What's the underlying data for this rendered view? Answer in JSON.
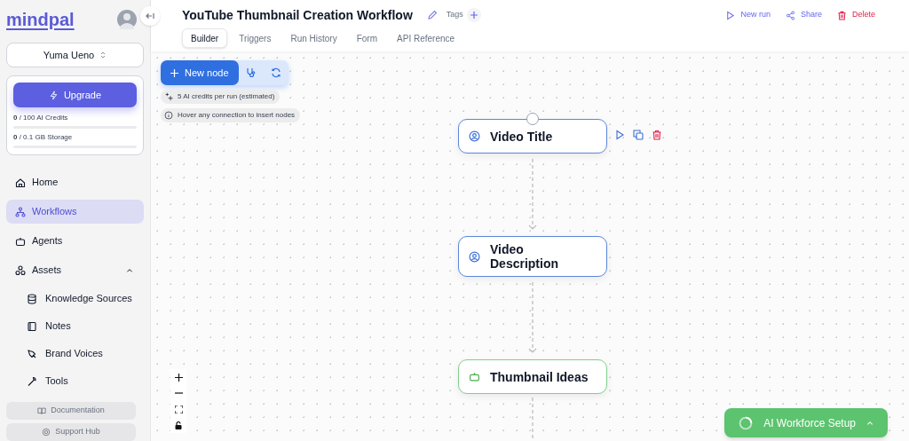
{
  "sidebar": {
    "logo": "mindpal",
    "user": "Yuma Ueno",
    "upgrade": "Upgrade",
    "usage": [
      {
        "used": "0",
        "label": "/ 100 AI Credits",
        "level": 0
      },
      {
        "used": "0",
        "label": "/ 0.1 GB Storage",
        "level": 0
      }
    ],
    "items": [
      {
        "label": "Home",
        "kind": "home",
        "selected": false
      },
      {
        "label": "Workflows",
        "kind": "workflow",
        "selected": true
      },
      {
        "label": "Agents",
        "kind": "robot",
        "selected": false
      },
      {
        "label": "Assets",
        "kind": "assets",
        "selected": false,
        "expanded": true,
        "children": [
          {
            "label": "Knowledge Sources",
            "kind": "database",
            "selected": false
          },
          {
            "label": "Notes",
            "kind": "notes",
            "selected": false
          },
          {
            "label": "Brand Voices",
            "kind": "pen",
            "selected": false
          },
          {
            "label": "Tools",
            "kind": "wrench",
            "selected": false
          }
        ]
      }
    ],
    "footer_links": [
      {
        "label": "Documentation",
        "kind": "book"
      },
      {
        "label": "Support Hub",
        "kind": "help"
      }
    ]
  },
  "header": {
    "title": "YouTube Thumbnail Creation Workflow",
    "tags_label": "Tags",
    "tabs": [
      {
        "label": "Builder",
        "selected": true
      },
      {
        "label": "Triggers",
        "selected": false
      },
      {
        "label": "Run History",
        "selected": false
      },
      {
        "label": "Form",
        "selected": false
      },
      {
        "label": "API Reference",
        "selected": false
      }
    ],
    "actions": [
      {
        "label": "New run",
        "kind": "run"
      },
      {
        "label": "Share",
        "kind": "share"
      },
      {
        "label": "Delete",
        "kind": "delete"
      }
    ]
  },
  "canvas": {
    "new_node": "New node",
    "info": [
      {
        "text": "5 AI credits per run (estimated)",
        "kind": "sparkle"
      },
      {
        "text": "Hover any connection to insert nodes",
        "kind": "info"
      }
    ],
    "nodes": [
      {
        "label": "Video Title",
        "kind": "input",
        "selected": true
      },
      {
        "label": "Video Description",
        "kind": "input",
        "selected": false
      },
      {
        "label": "Thumbnail Ideas",
        "kind": "agent",
        "selected": false
      }
    ],
    "setup_button": "AI Workforce Setup"
  }
}
